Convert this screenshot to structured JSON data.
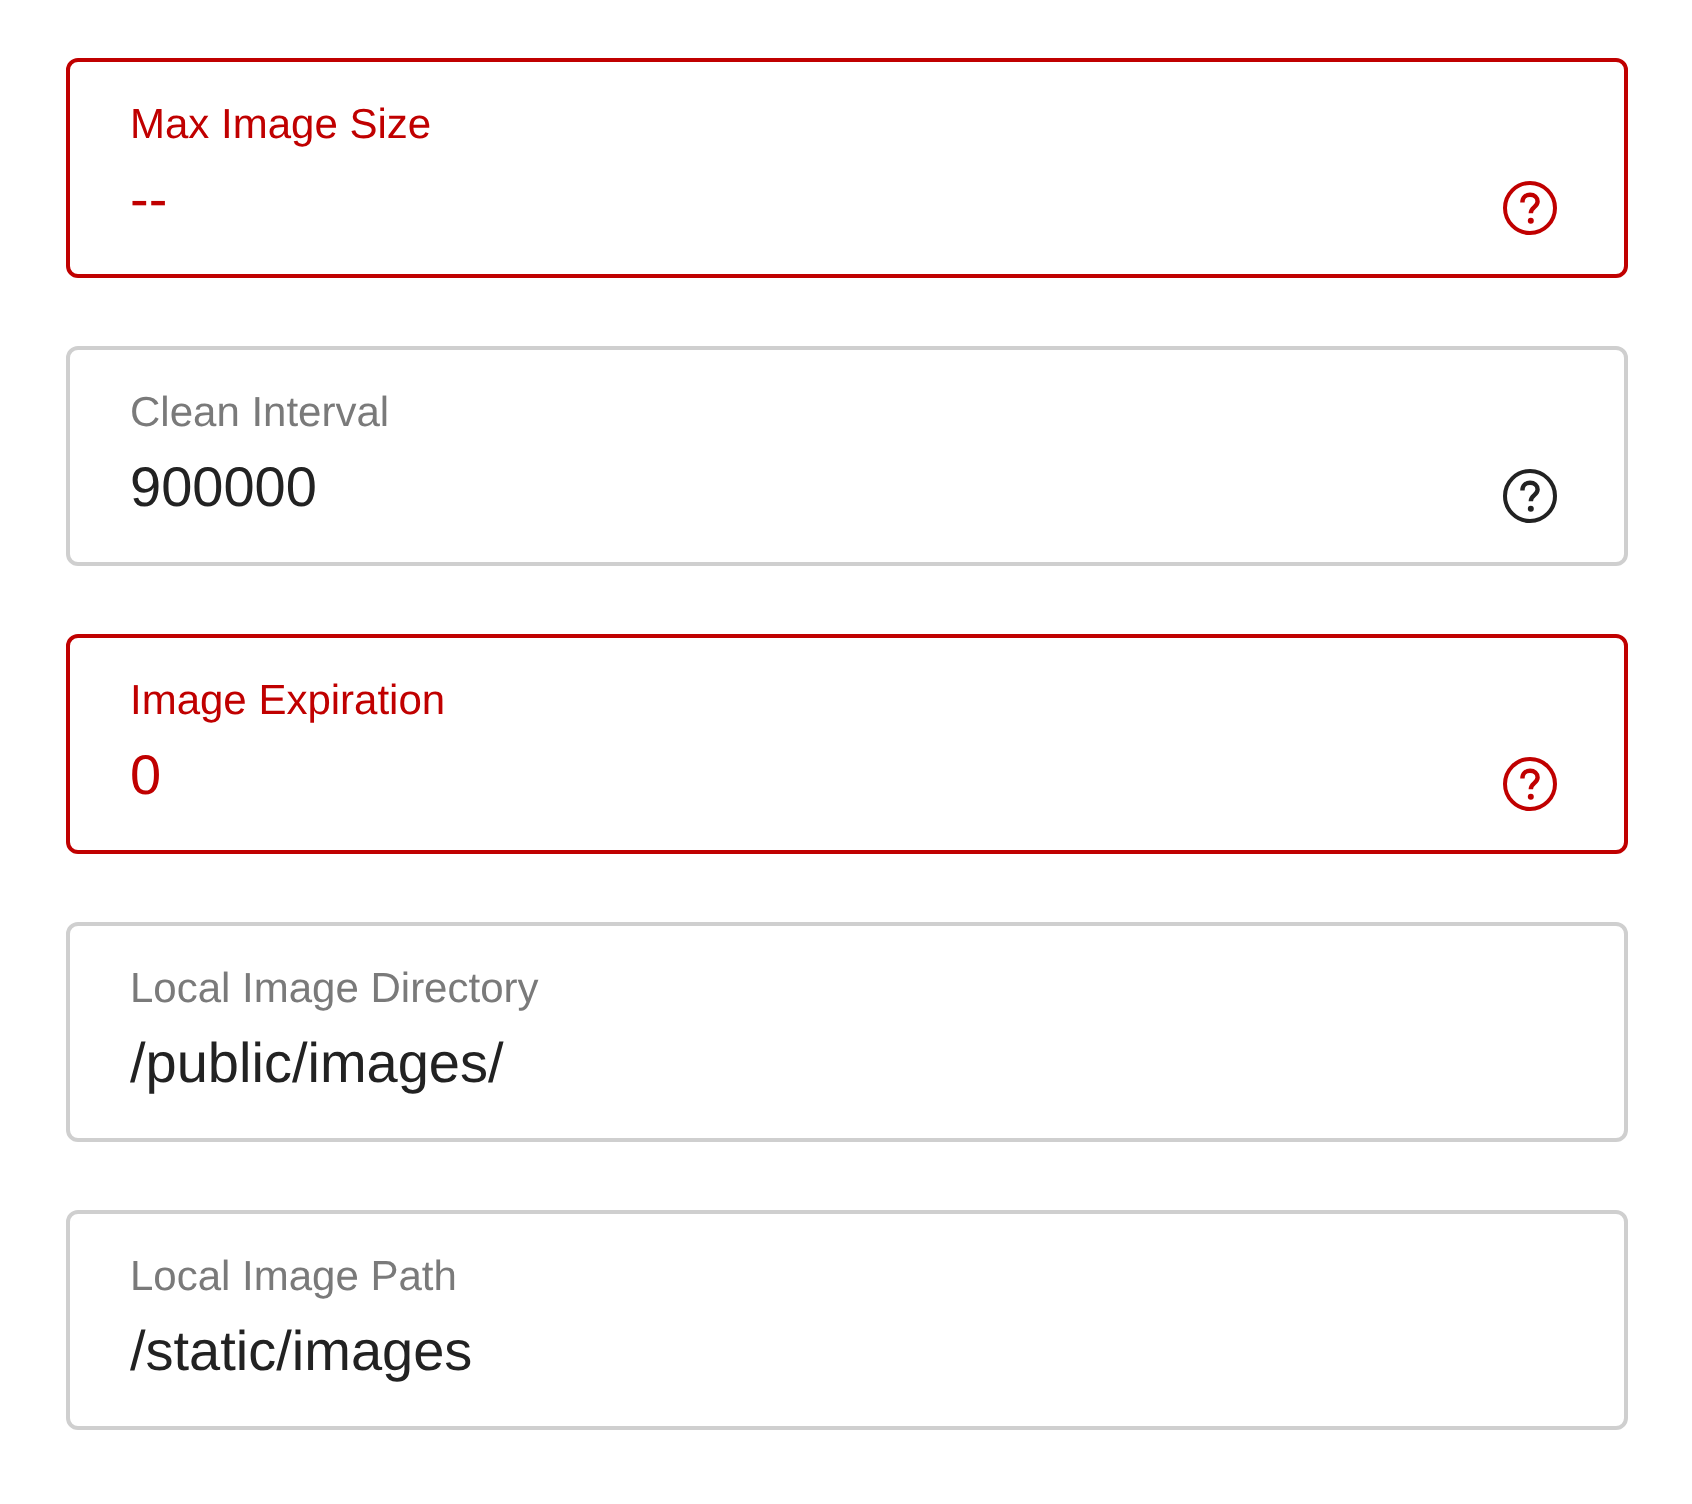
{
  "fields": [
    {
      "label": "Max Image Size",
      "value": "--",
      "error": true,
      "help": true
    },
    {
      "label": "Clean Interval",
      "value": "900000",
      "error": false,
      "help": true
    },
    {
      "label": "Image Expiration",
      "value": "0",
      "error": true,
      "help": true
    },
    {
      "label": "Local Image Directory",
      "value": "/public/images/",
      "error": false,
      "help": false
    },
    {
      "label": "Local Image Path",
      "value": "/static/images",
      "error": false,
      "help": false
    }
  ]
}
